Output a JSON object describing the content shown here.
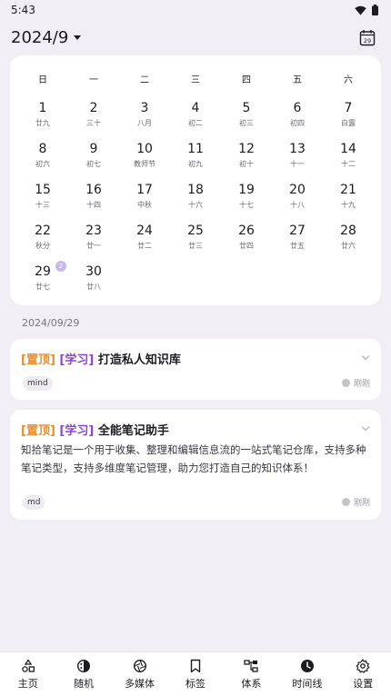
{
  "status": {
    "time": "5:43"
  },
  "header": {
    "month": "2024/9",
    "today_day": "29"
  },
  "calendar": {
    "weekdays": [
      "日",
      "一",
      "二",
      "三",
      "四",
      "五",
      "六"
    ],
    "days": [
      {
        "n": "1",
        "l": "廿九"
      },
      {
        "n": "2",
        "l": "三十"
      },
      {
        "n": "3",
        "l": "八月"
      },
      {
        "n": "4",
        "l": "初二"
      },
      {
        "n": "5",
        "l": "初三"
      },
      {
        "n": "6",
        "l": "初四"
      },
      {
        "n": "7",
        "l": "白露"
      },
      {
        "n": "8",
        "l": "初六"
      },
      {
        "n": "9",
        "l": "初七"
      },
      {
        "n": "10",
        "l": "教师节"
      },
      {
        "n": "11",
        "l": "初九"
      },
      {
        "n": "12",
        "l": "初十"
      },
      {
        "n": "13",
        "l": "十一"
      },
      {
        "n": "14",
        "l": "十二"
      },
      {
        "n": "15",
        "l": "十三"
      },
      {
        "n": "16",
        "l": "十四"
      },
      {
        "n": "17",
        "l": "中秋"
      },
      {
        "n": "18",
        "l": "十六"
      },
      {
        "n": "19",
        "l": "十七"
      },
      {
        "n": "20",
        "l": "十八"
      },
      {
        "n": "21",
        "l": "十九"
      },
      {
        "n": "22",
        "l": "秋分"
      },
      {
        "n": "23",
        "l": "廿一"
      },
      {
        "n": "24",
        "l": "廿二"
      },
      {
        "n": "25",
        "l": "廿三"
      },
      {
        "n": "26",
        "l": "廿四"
      },
      {
        "n": "27",
        "l": "廿五"
      },
      {
        "n": "28",
        "l": "廿六"
      },
      {
        "n": "29",
        "l": "廿七",
        "badge": "2"
      },
      {
        "n": "30",
        "l": "廿八"
      }
    ]
  },
  "date_label": "2024/09/29",
  "notes": [
    {
      "tag_top": "[置顶]",
      "tag_cat": "[学习]",
      "title": "打造私人知识库",
      "desc": "",
      "chip": "mind",
      "time": "刚刚"
    },
    {
      "tag_top": "[置顶]",
      "tag_cat": "[学习]",
      "title": "全能笔记助手",
      "desc": "知拾笔记是一个用于收集、整理和编辑信息流的一站式笔记仓库，支持多种笔记类型，支持多维度笔记管理，助力您打造自己的知识体系！",
      "chip": "md",
      "time": "刚刚"
    }
  ],
  "nav": [
    {
      "label": "主页",
      "icon": "shapes-icon"
    },
    {
      "label": "随机",
      "icon": "dice-icon"
    },
    {
      "label": "多媒体",
      "icon": "aperture-icon"
    },
    {
      "label": "标签",
      "icon": "bookmark-icon"
    },
    {
      "label": "体系",
      "icon": "hierarchy-icon"
    },
    {
      "label": "时间线",
      "icon": "clock-icon"
    },
    {
      "label": "设置",
      "icon": "gear-icon"
    }
  ]
}
